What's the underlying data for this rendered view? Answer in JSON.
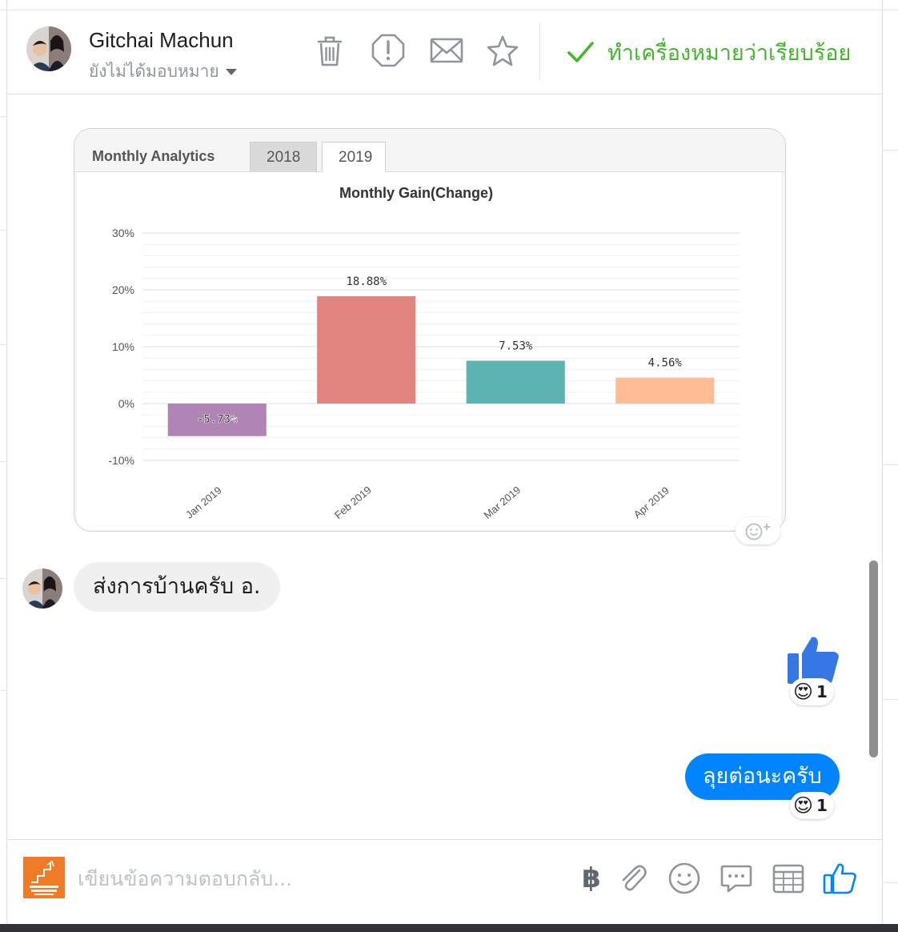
{
  "header": {
    "contact_name": "Gitchai Machun",
    "assign_status": "ยังไม่ได้มอบหมาย",
    "toolbar_icons": [
      "trash-icon",
      "report-icon",
      "mail-icon",
      "star-icon"
    ],
    "done_label": "ทำเครื่องหมายว่าเรียบร้อย",
    "accent_green": "#42b72a"
  },
  "chart_card": {
    "title": "Monthly Analytics",
    "tabs": [
      "2018",
      "2019"
    ],
    "selected_tab": "2019"
  },
  "chart_data": {
    "type": "bar",
    "title": "Monthly Gain(Change)",
    "categories": [
      "Jan 2019",
      "Feb 2019",
      "Mar 2019",
      "Apr 2019"
    ],
    "values": [
      -5.73,
      18.88,
      7.53,
      4.56
    ],
    "data_labels": [
      "-5.73%",
      "18.88%",
      "7.53%",
      "4.56%"
    ],
    "colors": [
      "#b085b5",
      "#e08480",
      "#5db3b1",
      "#ffbb93"
    ],
    "ylim": [
      -10,
      30
    ],
    "yticks": [
      30,
      20,
      10,
      0,
      -10
    ],
    "ytick_labels": [
      "30%",
      "20%",
      "10%",
      "0%",
      "-10%"
    ],
    "xlabel": "",
    "ylabel": "",
    "grid": true,
    "legend": "none"
  },
  "messages": [
    {
      "direction": "incoming",
      "text": "ส่งการบ้านครับ อ."
    },
    {
      "direction": "outgoing",
      "type": "like-sticker",
      "reaction": "😍",
      "reaction_count": "1"
    },
    {
      "direction": "outgoing",
      "text": "ลุยต่อนะครับ",
      "reaction": "😍",
      "reaction_count": "1"
    }
  ],
  "composer": {
    "placeholder": "เขียนข้อความตอบกลับ...",
    "currency_symbol": "฿",
    "icons": [
      "attach-icon",
      "emoji-icon",
      "saved-replies-icon",
      "appointment-icon",
      "like-icon"
    ],
    "brand_blue": "#0084ff"
  }
}
